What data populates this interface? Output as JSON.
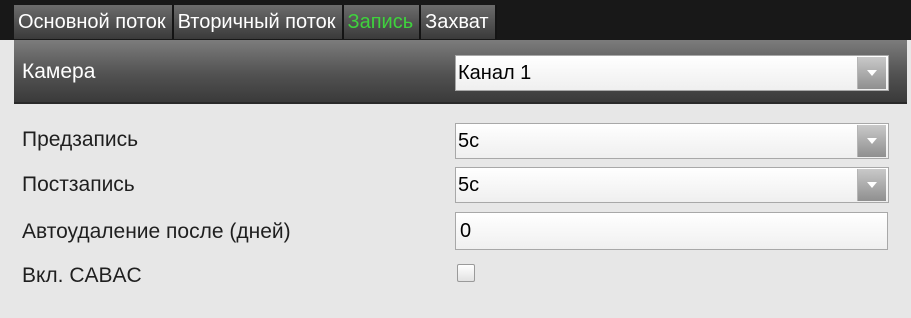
{
  "tabs": [
    {
      "label": "Основной поток",
      "active": false
    },
    {
      "label": "Вторичный поток",
      "active": false
    },
    {
      "label": "Запись",
      "active": true
    },
    {
      "label": "Захват",
      "active": false
    }
  ],
  "camera": {
    "label": "Камера",
    "value": "Канал 1"
  },
  "prerecord": {
    "label": "Предзапись",
    "value": "5с"
  },
  "postrecord": {
    "label": "Постзапись",
    "value": "5с"
  },
  "auto_delete": {
    "label": "Автоудаление после (дней)",
    "value": "0"
  },
  "cabac": {
    "label": "Вкл. CABAC",
    "checked": false
  },
  "colors": {
    "active_tab_text": "#3fd23d",
    "tab_bar_bg": "#181818",
    "panel_bg": "#e7e7e7"
  },
  "icons": {
    "dropdown_arrow": "chevron-down-icon"
  }
}
